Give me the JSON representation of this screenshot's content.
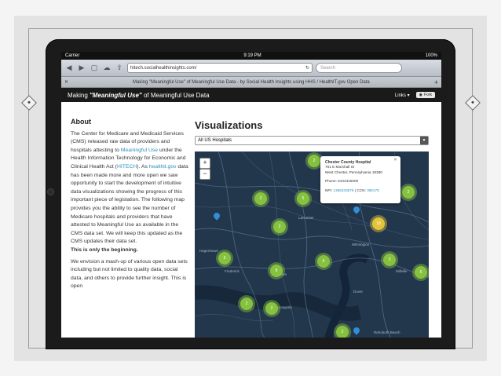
{
  "status": {
    "carrier": "Carrier",
    "time": "9:19 PM",
    "battery": "100%"
  },
  "browser": {
    "url": "hitech.socialhealthinsights.com/",
    "search_placeholder": "Search",
    "tab_title": "Making \"Meaningful Use\" of Meaningful Use Data - by Social Health Insights using HHS / HealthIT.gov Open Data"
  },
  "nav": {
    "title_prefix": "Making ",
    "title_em": "\"Meaningful Use\"",
    "title_suffix": " of Meaningful Use Data",
    "links_label": "Links",
    "fork_label": "Fork"
  },
  "about": {
    "heading": "About",
    "p1_a": "The Center for Medicare and Medicaid Services (CMS) released raw data of providers and hospitals attesting to ",
    "p1_link1": "Meaningful Use",
    "p1_b": " under the Health Information Technology for Economic and Clinical Health Act (",
    "p1_link2": "HITECH",
    "p1_c": "). As ",
    "p1_link3": "healthit.gov",
    "p1_d": " data has been made more and more open we saw opportunity to start the development of intuitive data visualizations showing the progress of this important piece of legislation. The following map provides you the ability to see the number of Medicare hospitals and providers that have attested to Meaningful Use as available in the CMS data set. We will keep this updated as the CMS updates their data set.",
    "p1_bold": "This is only the beginning.",
    "p2": "We envision a mash-up of various open data sets including but not limited to quality data, social data, and others to provide further insight. This is open"
  },
  "viz": {
    "heading": "Visualizations",
    "select_value": "All US Hospitals"
  },
  "map": {
    "zoom_in": "+",
    "zoom_out": "−",
    "popup": {
      "name": "Chester County Hospital",
      "addr1": "701 E Marshall St",
      "addr2": "West Chester, Pennsylvania 19380",
      "phone": "Phone: 6104315000",
      "npi_label": "NPI: ",
      "npi": "1356333579",
      "ccn_label": " | CCN: ",
      "ccn": "390179"
    },
    "clusters": [
      "2",
      "5",
      "2",
      "2",
      "8",
      "3",
      "6",
      "2",
      "2",
      "2",
      "5",
      "18",
      "3",
      "2"
    ],
    "labels": {
      "lancaster": "Lancaster",
      "hagerstown": "Hagerstown",
      "frederick": "Frederick",
      "baltimore": "Baltimore",
      "annapolis": "Annapolis",
      "wilmington": "Wilmington",
      "dover": "Dover",
      "millville": "Millville",
      "rehoboth": "Rehoboth Beach"
    }
  }
}
